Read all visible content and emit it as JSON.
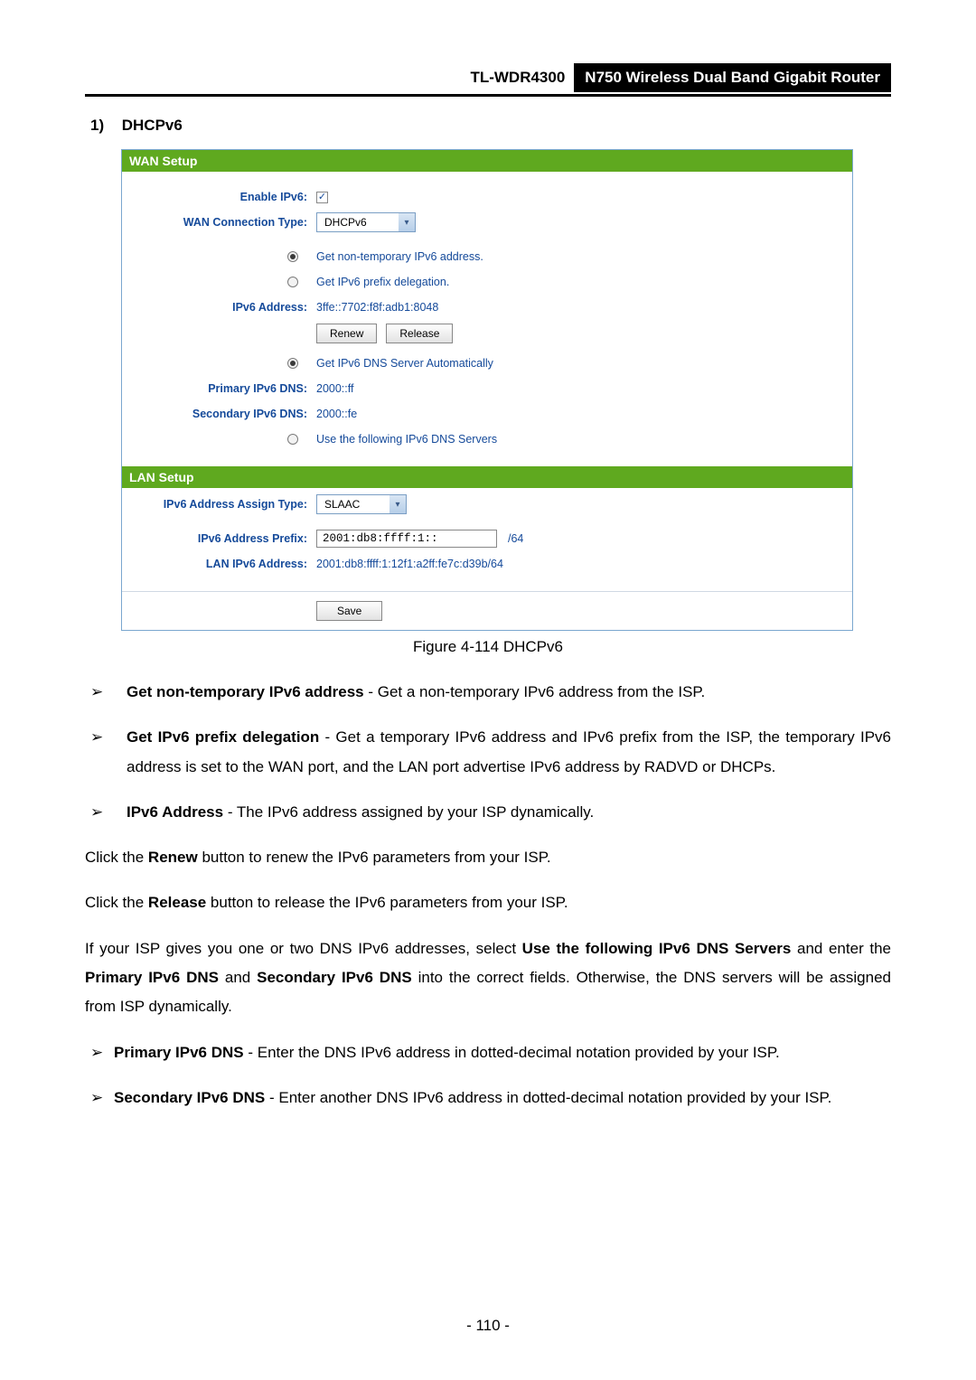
{
  "header": {
    "model": "TL-WDR4300",
    "description": "N750 Wireless Dual Band Gigabit Router"
  },
  "section": {
    "number": "1)",
    "title": "DHCPv6"
  },
  "panel": {
    "wanSetup": {
      "title": "WAN Setup",
      "enableIPv6Label": "Enable IPv6:",
      "enableIPv6Checked": "✓",
      "wanConnTypeLabel": "WAN Connection Type:",
      "wanConnTypeValue": "DHCPv6",
      "opt1": "Get non-temporary IPv6 address.",
      "opt2": "Get IPv6 prefix delegation.",
      "ipv6AddressLabel": "IPv6 Address:",
      "ipv6AddressValue": "3ffe::7702:f8f:adb1:8048",
      "renewBtn": "Renew",
      "releaseBtn": "Release",
      "dnsAutoOpt": "Get IPv6 DNS Server Automatically",
      "primaryDnsLabel": "Primary IPv6 DNS:",
      "primaryDnsValue": "2000::ff",
      "secondaryDnsLabel": "Secondary IPv6 DNS:",
      "secondaryDnsValue": "2000::fe",
      "dnsManualOpt": "Use the following IPv6 DNS Servers"
    },
    "lanSetup": {
      "title": "LAN Setup",
      "assignTypeLabel": "IPv6 Address Assign Type:",
      "assignTypeValue": "SLAAC",
      "prefixLabel": "IPv6 Address Prefix:",
      "prefixValue": "2001:db8:ffff:1::",
      "prefixSuffix": "/64",
      "lanAddrLabel": "LAN IPv6 Address:",
      "lanAddrValue": "2001:db8:ffff:1:12f1:a2ff:fe7c:d39b/64",
      "saveBtn": "Save"
    }
  },
  "figureCaption": "Figure 4-114 DHCPv6",
  "body": {
    "b1_bold": "Get non-temporary IPv6 address",
    "b1_rest": " - Get a non-temporary IPv6 address from the ISP.",
    "b2_bold": "Get IPv6 prefix delegation",
    "b2_rest": " - Get a temporary IPv6 address and IPv6 prefix from the ISP, the temporary IPv6 address is set to the WAN port, and the LAN port advertise IPv6 address by RADVD or DHCPs.",
    "b3_bold": "IPv6 Address",
    "b3_rest": " - The IPv6 address assigned by your ISP dynamically.",
    "p1_a": "Click the ",
    "p1_b": "Renew",
    "p1_c": " button to renew the IPv6 parameters from your ISP.",
    "p2_a": "Click the ",
    "p2_b": "Release",
    "p2_c": " button to release the IPv6 parameters from your ISP.",
    "p3_a": "If your ISP gives you one or two DNS IPv6 addresses, select ",
    "p3_b": "Use the following IPv6 DNS Servers",
    "p3_c": " and enter the ",
    "p3_d": "Primary IPv6 DNS",
    "p3_e": " and ",
    "p3_f": "Secondary IPv6 DNS",
    "p3_g": " into the correct fields. Otherwise, the DNS servers will be assigned from ISP dynamically.",
    "b4_bold": "Primary IPv6 DNS",
    "b4_rest": " - Enter the DNS IPv6 address in dotted-decimal notation provided by your ISP.",
    "b5_bold": "Secondary IPv6 DNS",
    "b5_rest": " - Enter another DNS IPv6 address in dotted-decimal notation provided by your ISP."
  },
  "pageNumber": "- 110 -",
  "arrowGlyph": "➢"
}
